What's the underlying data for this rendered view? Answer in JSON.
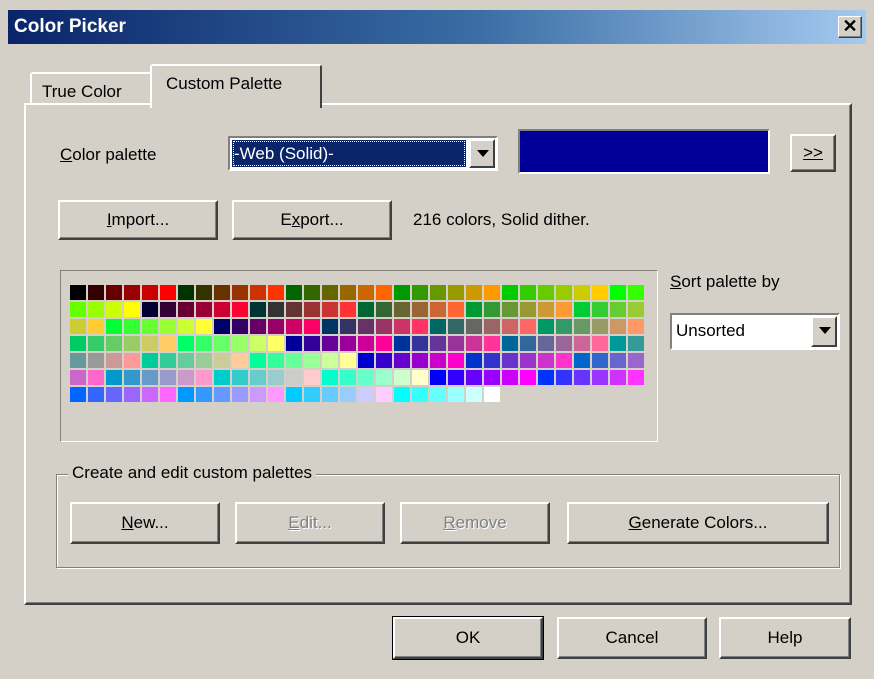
{
  "window": {
    "title": "Color Picker",
    "close_glyph": "✕"
  },
  "tabs": [
    {
      "label": "True Color",
      "active": false
    },
    {
      "label": "Custom Palette",
      "active": true
    }
  ],
  "palette_row": {
    "label_prefix": "C",
    "label_rest": "olor palette",
    "selected": "-Web (Solid)-",
    "preview_color": "#000099",
    "more_label": ">>"
  },
  "buttons": {
    "import_u": "I",
    "import_rest": "mport...",
    "export_pre": "E",
    "export_u": "x",
    "export_rest": "port...",
    "new_u": "N",
    "new_rest": "ew...",
    "edit_u": "E",
    "edit_rest": "dit...",
    "remove_u": "R",
    "remove_rest": "emove",
    "generate_u": "G",
    "generate_rest": "enerate Colors...",
    "ok": "OK",
    "cancel": "Cancel",
    "help": "Help"
  },
  "status_text": "216 colors, Solid dither.",
  "sort": {
    "label_u": "S",
    "label_rest": "ort palette by",
    "value": "Unsorted"
  },
  "group_label": "Create and edit custom palettes",
  "palette_colors": [
    "#000000",
    "#330000",
    "#660000",
    "#990000",
    "#cc0000",
    "#ff0000",
    "#003300",
    "#333300",
    "#663300",
    "#993300",
    "#cc3300",
    "#ff3300",
    "#006600",
    "#336600",
    "#666600",
    "#996600",
    "#cc6600",
    "#ff6600",
    "#009900",
    "#339900",
    "#669900",
    "#999900",
    "#cc9900",
    "#ff9900",
    "#00cc00",
    "#33cc00",
    "#66cc00",
    "#99cc00",
    "#cccc00",
    "#ffcc00",
    "#00ff00",
    "#33ff00",
    "#66ff00",
    "#99ff00",
    "#ccff00",
    "#ffff00",
    "#000033",
    "#330033",
    "#660033",
    "#990033",
    "#cc0033",
    "#ff0033",
    "#003333",
    "#333333",
    "#663333",
    "#993333",
    "#cc3333",
    "#ff3333",
    "#006633",
    "#336633",
    "#666633",
    "#996633",
    "#cc6633",
    "#ff6633",
    "#009933",
    "#339933",
    "#669933",
    "#999933",
    "#cc9933",
    "#ff9933",
    "#00cc33",
    "#33cc33",
    "#66cc33",
    "#99cc33",
    "#cccc33",
    "#ffcc33",
    "#00ff33",
    "#33ff33",
    "#66ff33",
    "#99ff33",
    "#ccff33",
    "#ffff33",
    "#000066",
    "#330066",
    "#660066",
    "#990066",
    "#cc0066",
    "#ff0066",
    "#003366",
    "#333366",
    "#663366",
    "#993366",
    "#cc3366",
    "#ff3366",
    "#006666",
    "#336666",
    "#666666",
    "#996666",
    "#cc6666",
    "#ff6666",
    "#009966",
    "#339966",
    "#669966",
    "#999966",
    "#cc9966",
    "#ff9966",
    "#00cc66",
    "#33cc66",
    "#66cc66",
    "#99cc66",
    "#cccc66",
    "#ffcc66",
    "#00ff66",
    "#33ff66",
    "#66ff66",
    "#99ff66",
    "#ccff66",
    "#ffff66",
    "#000099",
    "#330099",
    "#660099",
    "#990099",
    "#cc0099",
    "#ff0099",
    "#003399",
    "#333399",
    "#663399",
    "#993399",
    "#cc3399",
    "#ff3399",
    "#006699",
    "#336699",
    "#666699",
    "#996699",
    "#cc6699",
    "#ff6699",
    "#009999",
    "#339999",
    "#669999",
    "#999999",
    "#cc9999",
    "#ff9999",
    "#00cc99",
    "#33cc99",
    "#66cc99",
    "#99cc99",
    "#cccc99",
    "#ffcc99",
    "#00ff99",
    "#33ff99",
    "#66ff99",
    "#99ff99",
    "#ccff99",
    "#ffff99",
    "#0000cc",
    "#3300cc",
    "#6600cc",
    "#9900cc",
    "#cc00cc",
    "#ff00cc",
    "#0033cc",
    "#3333cc",
    "#6633cc",
    "#9933cc",
    "#cc33cc",
    "#ff33cc",
    "#0066cc",
    "#3366cc",
    "#6666cc",
    "#9966cc",
    "#cc66cc",
    "#ff66cc",
    "#0099cc",
    "#3399cc",
    "#6699cc",
    "#9999cc",
    "#cc99cc",
    "#ff99cc",
    "#00cccc",
    "#33cccc",
    "#66cccc",
    "#99cccc",
    "#cccccc",
    "#ffcccc",
    "#00ffcc",
    "#33ffcc",
    "#66ffcc",
    "#99ffcc",
    "#ccffcc",
    "#ffffcc",
    "#0000ff",
    "#3300ff",
    "#6600ff",
    "#9900ff",
    "#cc00ff",
    "#ff00ff",
    "#0033ff",
    "#3333ff",
    "#6633ff",
    "#9933ff",
    "#cc33ff",
    "#ff33ff",
    "#0066ff",
    "#3366ff",
    "#6666ff",
    "#9966ff",
    "#cc66ff",
    "#ff66ff",
    "#0099ff",
    "#3399ff",
    "#6699ff",
    "#9999ff",
    "#cc99ff",
    "#ff99ff",
    "#00ccff",
    "#33ccff",
    "#66ccff",
    "#99ccff",
    "#ccccff",
    "#ffccff",
    "#00ffff",
    "#33ffff",
    "#66ffff",
    "#99ffff",
    "#ccffff",
    "#ffffff"
  ]
}
